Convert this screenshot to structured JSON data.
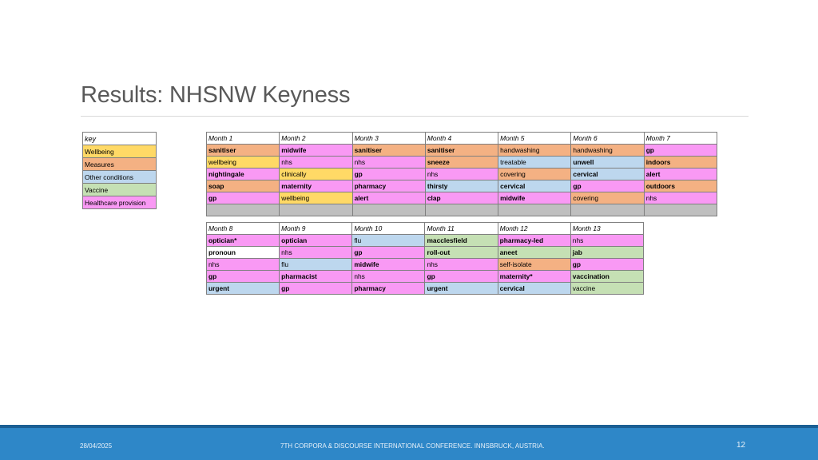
{
  "title": "Results: NHSNW Keyness",
  "colors": {
    "Wellbeing": "#ffd966",
    "Measures": "#f4b183",
    "Other conditions": "#bdd7ee",
    "Vaccine": "#c5e0b4",
    "Healthcare provision": "#f999f4",
    "none": "#ffffff"
  },
  "key": {
    "heading": "key",
    "items": [
      {
        "label": "Wellbeing",
        "cat": "Wellbeing"
      },
      {
        "label": "Measures",
        "cat": "Measures"
      },
      {
        "label": "Other conditions",
        "cat": "Other conditions"
      },
      {
        "label": "Vaccine",
        "cat": "Vaccine"
      },
      {
        "label": "Healthcare provision",
        "cat": "Healthcare provision"
      }
    ]
  },
  "top_block": {
    "headers": [
      "Month 1",
      "Month 2",
      "Month 3",
      "Month 4",
      "Month 5",
      "Month 6",
      "Month 7"
    ],
    "rows": [
      [
        {
          "t": "sanitiser",
          "c": "Measures",
          "b": true
        },
        {
          "t": "midwife",
          "c": "Healthcare provision",
          "b": true
        },
        {
          "t": "sanitiser",
          "c": "Measures",
          "b": true
        },
        {
          "t": "sanitiser",
          "c": "Measures",
          "b": true
        },
        {
          "t": "handwashing",
          "c": "Measures",
          "b": false
        },
        {
          "t": "handwashing",
          "c": "Measures",
          "b": false
        },
        {
          "t": "gp",
          "c": "Healthcare provision",
          "b": true
        }
      ],
      [
        {
          "t": "wellbeing",
          "c": "Wellbeing",
          "b": false
        },
        {
          "t": "nhs",
          "c": "Healthcare provision",
          "b": false
        },
        {
          "t": "nhs",
          "c": "Healthcare provision",
          "b": false
        },
        {
          "t": "sneeze",
          "c": "Measures",
          "b": true
        },
        {
          "t": "treatable",
          "c": "Other conditions",
          "b": false
        },
        {
          "t": "unwell",
          "c": "Other conditions",
          "b": true
        },
        {
          "t": "indoors",
          "c": "Measures",
          "b": true
        }
      ],
      [
        {
          "t": "nightingale",
          "c": "Healthcare provision",
          "b": true
        },
        {
          "t": "clinically",
          "c": "Wellbeing",
          "b": false
        },
        {
          "t": "gp",
          "c": "Healthcare provision",
          "b": true
        },
        {
          "t": "nhs",
          "c": "Healthcare provision",
          "b": false
        },
        {
          "t": "covering",
          "c": "Measures",
          "b": false
        },
        {
          "t": "cervical",
          "c": "Other conditions",
          "b": true
        },
        {
          "t": "alert",
          "c": "Healthcare provision",
          "b": true
        }
      ],
      [
        {
          "t": "soap",
          "c": "Measures",
          "b": true
        },
        {
          "t": "maternity",
          "c": "Healthcare provision",
          "b": true
        },
        {
          "t": "pharmacy",
          "c": "Healthcare provision",
          "b": true
        },
        {
          "t": "thirsty",
          "c": "Other conditions",
          "b": true
        },
        {
          "t": "cervical",
          "c": "Other conditions",
          "b": true
        },
        {
          "t": "gp",
          "c": "Healthcare provision",
          "b": true
        },
        {
          "t": "outdoors",
          "c": "Measures",
          "b": true
        }
      ],
      [
        {
          "t": "gp",
          "c": "Healthcare provision",
          "b": true
        },
        {
          "t": "wellbeing",
          "c": "Wellbeing",
          "b": false
        },
        {
          "t": "alert",
          "c": "Healthcare provision",
          "b": true
        },
        {
          "t": "clap",
          "c": "Healthcare provision",
          "b": true
        },
        {
          "t": "midwife",
          "c": "Healthcare provision",
          "b": true
        },
        {
          "t": "covering",
          "c": "Measures",
          "b": false
        },
        {
          "t": "nhs",
          "c": "Healthcare provision",
          "b": false
        }
      ]
    ]
  },
  "bottom_block": {
    "headers": [
      "Month 8",
      "Month 9",
      "Month 10",
      "Month 11",
      "Month 12",
      "Month 13"
    ],
    "rows": [
      [
        {
          "t": "optician*",
          "c": "Healthcare provision",
          "b": true
        },
        {
          "t": "optician",
          "c": "Healthcare provision",
          "b": true
        },
        {
          "t": "flu",
          "c": "Other conditions",
          "b": false
        },
        {
          "t": "macclesfield",
          "c": "Vaccine",
          "b": true
        },
        {
          "t": "pharmacy-led",
          "c": "Healthcare provision",
          "b": true
        },
        {
          "t": "nhs",
          "c": "Healthcare provision",
          "b": false
        }
      ],
      [
        {
          "t": "pronoun",
          "c": "none",
          "b": true
        },
        {
          "t": "nhs",
          "c": "Healthcare provision",
          "b": false
        },
        {
          "t": "gp",
          "c": "Healthcare provision",
          "b": true
        },
        {
          "t": "roll-out",
          "c": "Vaccine",
          "b": true
        },
        {
          "t": "aneet",
          "c": "Vaccine",
          "b": true
        },
        {
          "t": "jab",
          "c": "Vaccine",
          "b": true
        }
      ],
      [
        {
          "t": "nhs",
          "c": "Healthcare provision",
          "b": false
        },
        {
          "t": "flu",
          "c": "Other conditions",
          "b": false
        },
        {
          "t": "midwife",
          "c": "Healthcare provision",
          "b": true
        },
        {
          "t": "nhs",
          "c": "Healthcare provision",
          "b": false
        },
        {
          "t": "self-isolate",
          "c": "Measures",
          "b": false
        },
        {
          "t": "gp",
          "c": "Healthcare provision",
          "b": true
        }
      ],
      [
        {
          "t": "gp",
          "c": "Healthcare provision",
          "b": true
        },
        {
          "t": "pharmacist",
          "c": "Healthcare provision",
          "b": true
        },
        {
          "t": "nhs",
          "c": "Healthcare provision",
          "b": false
        },
        {
          "t": "gp",
          "c": "Healthcare provision",
          "b": true
        },
        {
          "t": "maternity*",
          "c": "Healthcare provision",
          "b": true
        },
        {
          "t": "vaccination",
          "c": "Vaccine",
          "b": true
        }
      ],
      [
        {
          "t": "urgent",
          "c": "Other conditions",
          "b": true
        },
        {
          "t": "gp",
          "c": "Healthcare provision",
          "b": true
        },
        {
          "t": "pharmacy",
          "c": "Healthcare provision",
          "b": true
        },
        {
          "t": "urgent",
          "c": "Other conditions",
          "b": true
        },
        {
          "t": "cervical",
          "c": "Other conditions",
          "b": true
        },
        {
          "t": "vaccine",
          "c": "Vaccine",
          "b": false
        }
      ]
    ]
  },
  "footer": {
    "date": "28/04/2025",
    "conference": "7TH CORPORA & DISCOURSE INTERNATIONAL CONFERENCE. INNSBRUCK, AUSTRIA.",
    "page": "12"
  }
}
